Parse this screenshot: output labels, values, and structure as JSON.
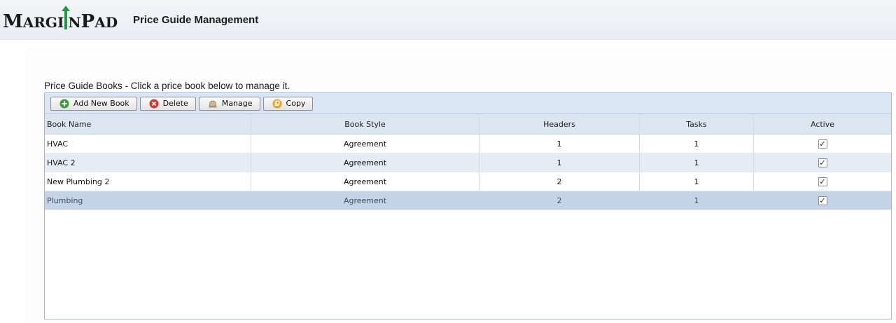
{
  "app": {
    "logo_first": "M",
    "logo_rest_a": "ARGI",
    "logo_n": "N",
    "logo_p": "P",
    "logo_rest_b": "AD",
    "page_title": "Price Guide Management"
  },
  "grid": {
    "caption": "Price Guide Books - Click a price book below to manage it.",
    "toolbar": [
      {
        "label": "Add New Book",
        "icon": "add-icon"
      },
      {
        "label": "Delete",
        "icon": "delete-icon"
      },
      {
        "label": "Manage",
        "icon": "manage-icon"
      },
      {
        "label": "Copy",
        "icon": "copy-icon"
      }
    ],
    "columns": [
      "Book Name",
      "Book Style",
      "Headers",
      "Tasks",
      "Active"
    ],
    "rows": [
      {
        "name": "HVAC",
        "style": "Agreement",
        "headers": "1",
        "tasks": "1",
        "active": true
      },
      {
        "name": "HVAC 2",
        "style": "Agreement",
        "headers": "1",
        "tasks": "1",
        "active": true
      },
      {
        "name": "New Plumbing 2",
        "style": "Agreement",
        "headers": "2",
        "tasks": "1",
        "active": true
      },
      {
        "name": "Plumbing",
        "style": "Agreement",
        "headers": "2",
        "tasks": "1",
        "active": true
      }
    ],
    "selected_row": 3
  },
  "colors": {
    "logo_green": "#1f9a45",
    "grid_border": "#99bbe8",
    "selected_row": "#c4d4e6"
  }
}
